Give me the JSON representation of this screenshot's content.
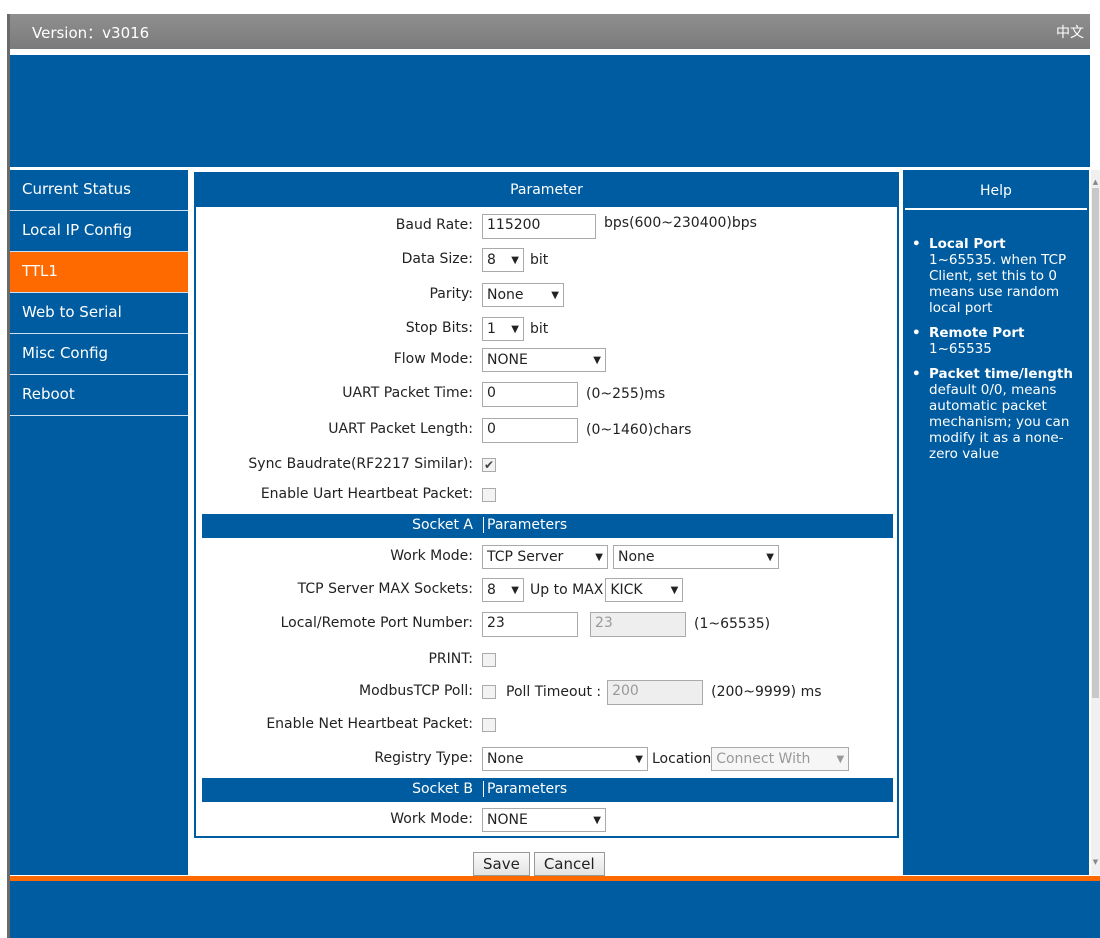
{
  "topbar": {
    "version": "Version：v3016",
    "lang": "中文"
  },
  "sidebar": {
    "items": [
      "Current Status",
      "Local IP Config",
      "TTL1",
      "Web to Serial",
      "Misc Config",
      "Reboot"
    ]
  },
  "panel": {
    "title": "Parameter"
  },
  "serial": {
    "baud_label": "Baud Rate:",
    "baud_value": "115200",
    "baud_hint": "bps(600~230400)bps",
    "datasize_label": "Data Size:",
    "datasize_value": "8",
    "datasize_unit": "bit",
    "parity_label": "Parity:",
    "parity_value": "None",
    "stopbits_label": "Stop Bits:",
    "stopbits_value": "1",
    "stopbits_unit": "bit",
    "flow_label": "Flow Mode:",
    "flow_value": "NONE",
    "ptime_label": "UART Packet Time:",
    "ptime_value": "0",
    "ptime_hint": "(0~255)ms",
    "plen_label": "UART Packet Length:",
    "plen_value": "0",
    "plen_hint": "(0~1460)chars",
    "sync_label": "Sync Baudrate(RF2217 Similar):",
    "sync_checked": true,
    "uart_hb_label": "Enable Uart Heartbeat Packet:",
    "uart_hb_checked": false
  },
  "socketA": {
    "title_left": "Socket A",
    "title_right": "Parameters",
    "work_label": "Work Mode:",
    "work_value": "TCP Server",
    "work_sub_value": "None",
    "max_label": "TCP Server MAX Sockets:",
    "max_value": "8",
    "max_text": "Up to MAX",
    "max_action": "KICK",
    "port_label": "Local/Remote Port Number:",
    "local_port": "23",
    "remote_port": "23",
    "port_hint": "(1~65535)",
    "print_label": "PRINT:",
    "modbus_label": "ModbusTCP Poll:",
    "poll_timeout_label": "Poll Timeout :",
    "poll_timeout_value": "200",
    "poll_hint": "(200~9999) ms",
    "net_hb_label": "Enable Net Heartbeat Packet:",
    "reg_label": "Registry Type:",
    "reg_value": "None",
    "location_label": "Location",
    "location_value": "Connect With"
  },
  "socketB": {
    "title_left": "Socket B",
    "title_right": "Parameters",
    "work_label": "Work Mode:",
    "work_value": "NONE"
  },
  "buttons": {
    "save": "Save",
    "cancel": "Cancel"
  },
  "help": {
    "title": "Help",
    "items": [
      {
        "head": "Local Port",
        "body": "1~65535. when TCP Client, set this to 0 means use random local port"
      },
      {
        "head": "Remote Port",
        "body": "1~65535"
      },
      {
        "head": "Packet time/length",
        "body": "default 0/0, means automatic packet mechanism; you can modify it as a none-zero value"
      }
    ]
  },
  "colors": {
    "brand_blue": "#005ca0",
    "active_orange": "#ff6a00",
    "topbar_gray": "#808080"
  }
}
